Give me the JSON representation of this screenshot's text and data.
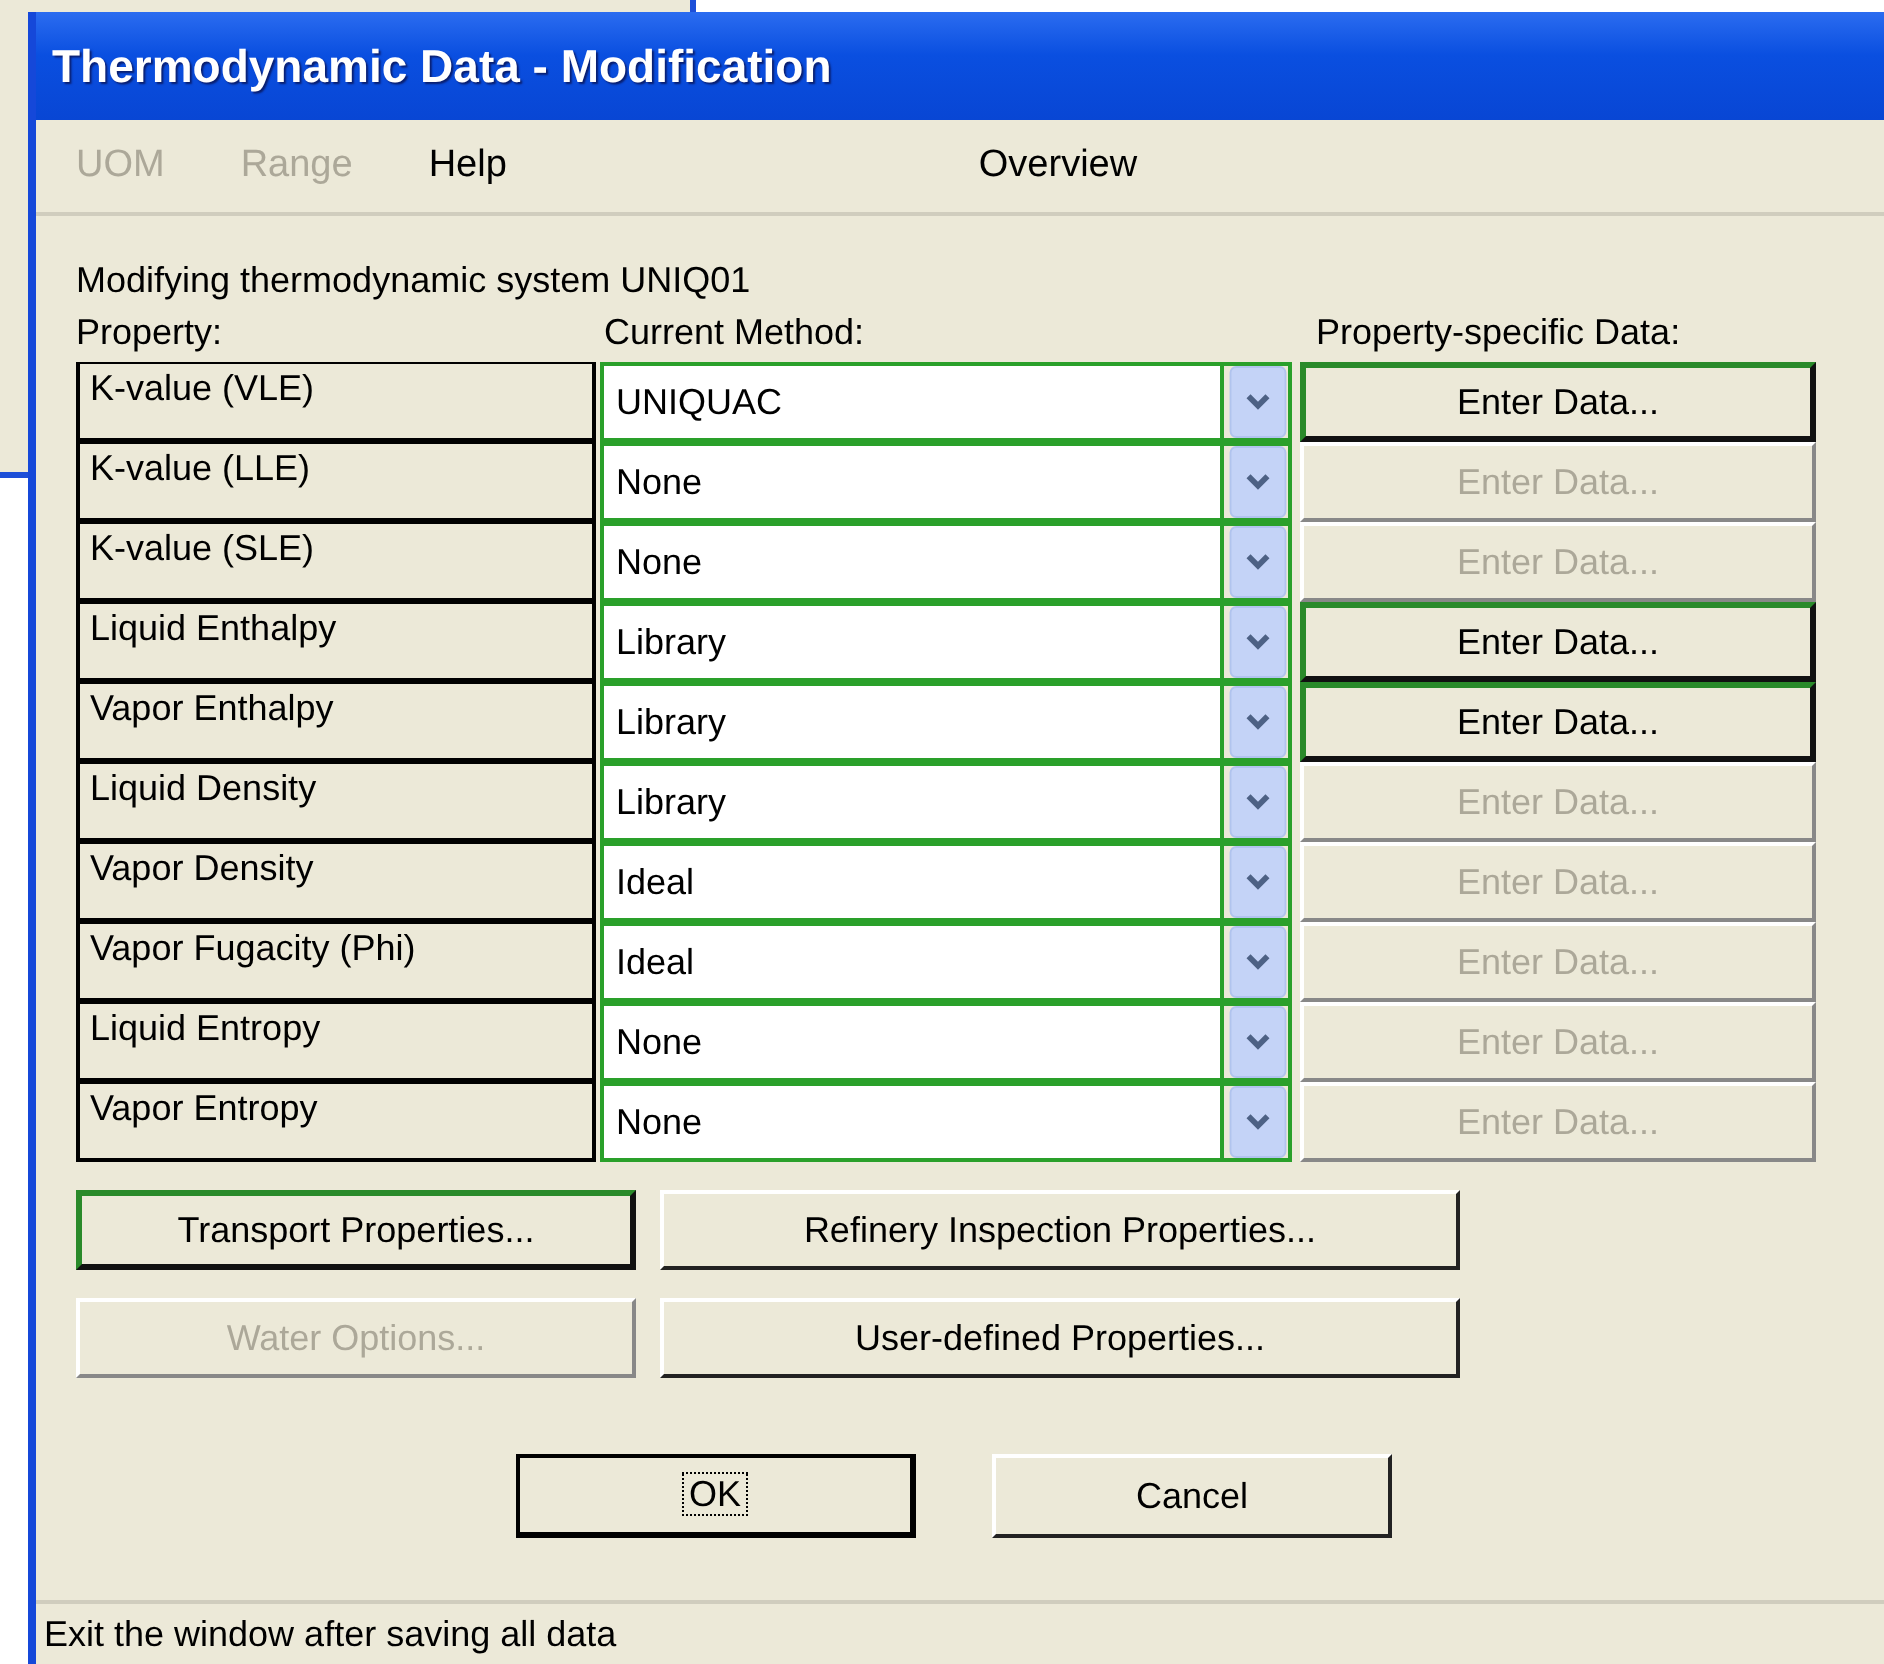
{
  "window": {
    "title": "Thermodynamic Data - Modification"
  },
  "menu": [
    {
      "label": "UOM",
      "disabled": true
    },
    {
      "label": "Range",
      "disabled": true
    },
    {
      "label": "Help",
      "disabled": false
    }
  ],
  "overview": "Overview",
  "intro": "Modifying thermodynamic system UNIQ01",
  "headers": {
    "property": "Property:",
    "method": "Current Method:",
    "data": "Property-specific Data:"
  },
  "rows": [
    {
      "property": "K-value (VLE)",
      "method": "UNIQUAC",
      "button": "Enter Data...",
      "disabled": false
    },
    {
      "property": "K-value (LLE)",
      "method": "None",
      "button": "Enter Data...",
      "disabled": true
    },
    {
      "property": "K-value (SLE)",
      "method": "None",
      "button": "Enter Data...",
      "disabled": true
    },
    {
      "property": "Liquid Enthalpy",
      "method": "Library",
      "button": "Enter Data...",
      "disabled": false
    },
    {
      "property": "Vapor Enthalpy",
      "method": "Library",
      "button": "Enter Data...",
      "disabled": false
    },
    {
      "property": "Liquid Density",
      "method": "Library",
      "button": "Enter Data...",
      "disabled": true
    },
    {
      "property": "Vapor Density",
      "method": "Ideal",
      "button": "Enter Data...",
      "disabled": true
    },
    {
      "property": "Vapor Fugacity (Phi)",
      "method": "Ideal",
      "button": "Enter Data...",
      "disabled": true
    },
    {
      "property": "Liquid Entropy",
      "method": "None",
      "button": "Enter Data...",
      "disabled": true
    },
    {
      "property": "Vapor Entropy",
      "method": "None",
      "button": "Enter Data...",
      "disabled": true
    }
  ],
  "extra_buttons": [
    {
      "label": "Transport Properties...",
      "disabled": false,
      "focused": true
    },
    {
      "label": "Refinery Inspection Properties...",
      "disabled": false,
      "focused": false
    },
    {
      "label": "Water Options...",
      "disabled": true,
      "focused": false
    },
    {
      "label": "User-defined Properties...",
      "disabled": false,
      "focused": false
    }
  ],
  "ok": "OK",
  "cancel": "Cancel",
  "status_bar": "Exit the window after saving all data"
}
